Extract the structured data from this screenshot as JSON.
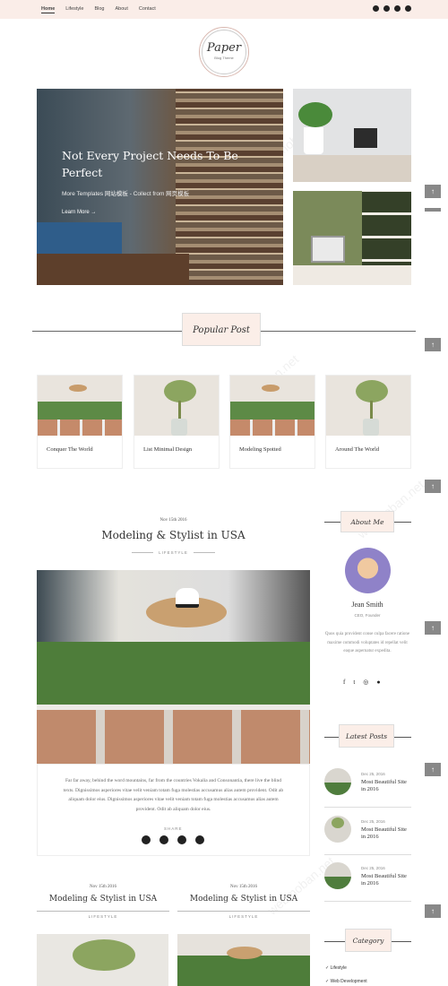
{
  "nav": {
    "items": [
      "Home",
      "Lifestyle",
      "Blog",
      "About",
      "Contact"
    ]
  },
  "social_header": [
    "twitter-icon",
    "facebook-icon",
    "linkedin-icon",
    "dribbble-icon"
  ],
  "logo": {
    "title": "Paper",
    "subtitle": "Blog Theme"
  },
  "hero": {
    "title": "Not Every Project Needs To Be Perfect",
    "subtitle": "More Templates 网站模板 - Collect from 网页模板",
    "link": "Learn More"
  },
  "watermark": "webmoban.net",
  "popular": {
    "heading": "Popular Post",
    "posts": [
      {
        "title": "Conquer The World",
        "image": "pots"
      },
      {
        "title": "List Minimal Design",
        "image": "tree"
      },
      {
        "title": "Modeling Spotted",
        "image": "pots"
      },
      {
        "title": "Around The World",
        "image": "tree"
      }
    ]
  },
  "article": {
    "date": "Nov 15th 2016",
    "title": "Modeling & Stylist in USA",
    "category": "LIFESTYLE",
    "body": "Far far away, behind the word mountains, far from the countries Vokalia and Consonantia, there live the blind texts. Dignissimos asperiores vitae velit veniam totam fuga molestias accusamus alias autem provident. Odit ab aliquam dolor eius. Dignissimos asperiores vitae velit veniam totam fuga molestias accusamus alias autem provident. Odit ab aliquam dolor eius.",
    "share_label": "SHARE"
  },
  "grid_posts": [
    {
      "date": "Nov 15th 2016",
      "title": "Modeling & Stylist in USA",
      "category": "LIFESTYLE"
    },
    {
      "date": "Nov 15th 2016",
      "title": "Modeling & Stylist in USA",
      "category": "LIFESTYLE"
    }
  ],
  "sidebar": {
    "about": {
      "heading": "About Me",
      "name": "Jean Smith",
      "role": "CEO, Founder",
      "text": "Quos quia provident conse culpa facere ratione maxime commodi voluptates id repellat velit eaque aspernatur expedita.",
      "icons": [
        "facebook-icon",
        "twitter-icon",
        "instagram-icon",
        "github-icon"
      ]
    },
    "latest": {
      "heading": "Latest Posts",
      "posts": [
        {
          "date": "Dec 25, 2016",
          "title": "Most Beautiful Site in 2016"
        },
        {
          "date": "Dec 25, 2016",
          "title": "Most Beautiful Site in 2016"
        },
        {
          "date": "Dec 25, 2016",
          "title": "Most Beautiful Site in 2016"
        }
      ]
    },
    "category": {
      "heading": "Category",
      "items": [
        "Lifestyle",
        "Web Development"
      ]
    }
  },
  "scroll_top_label": "↑"
}
